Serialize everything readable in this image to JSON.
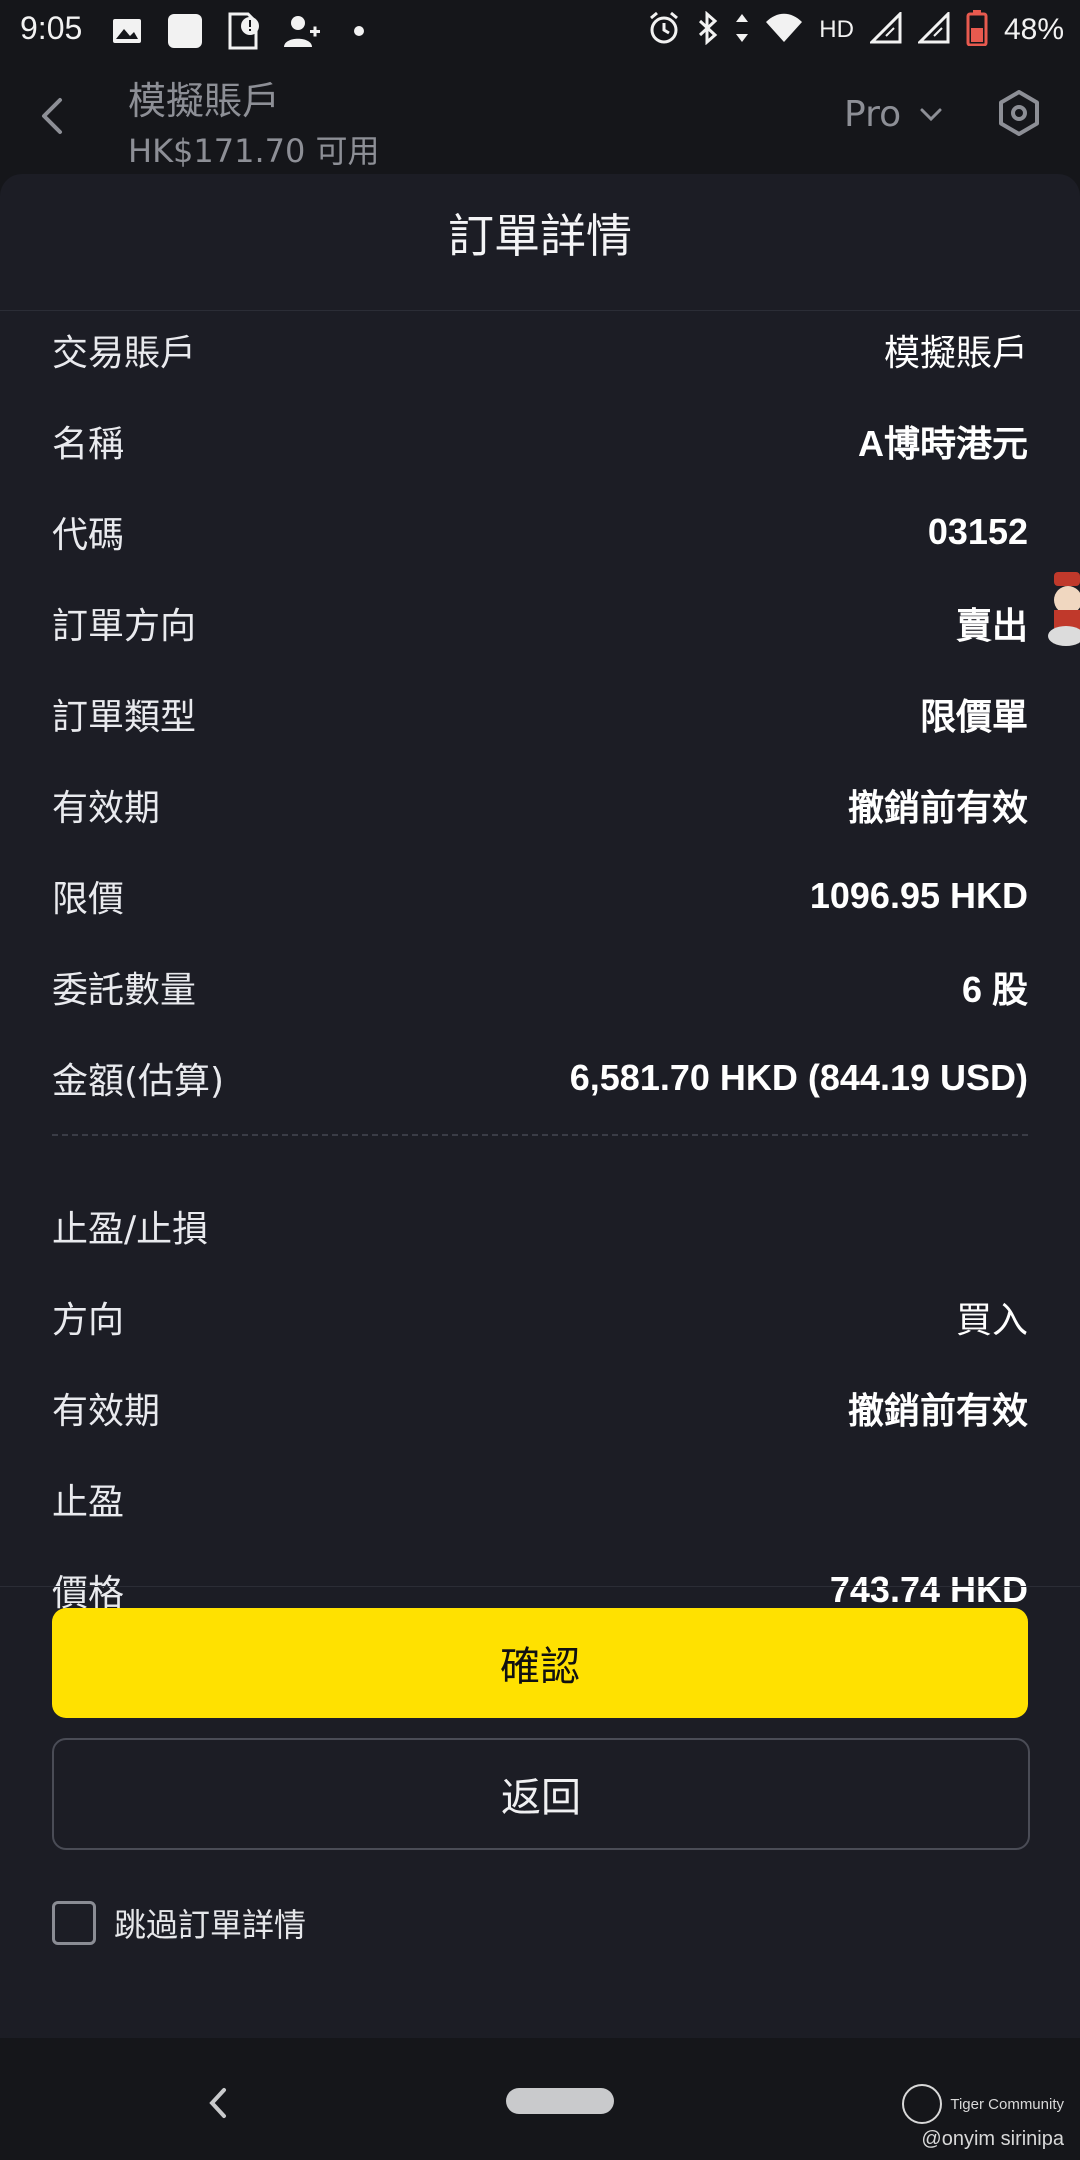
{
  "status_bar": {
    "time": "9:05",
    "battery": "48%",
    "network": "HD",
    "left_icons": [
      "image-icon",
      "square-icon",
      "sim-alert-icon",
      "person-add-icon",
      "dot-icon"
    ],
    "right_icons": [
      "alarm-icon",
      "bluetooth-icon",
      "data-arrows-icon",
      "wifi-icon",
      "signal-icon",
      "signal-icon",
      "battery-icon"
    ]
  },
  "header": {
    "account_name": "模擬賬戶",
    "available": "HK$171.70 可用",
    "mode": "Pro"
  },
  "sheet": {
    "title": "訂單詳情",
    "order_rows": [
      {
        "label": "交易賬戶",
        "value": "模擬賬戶"
      },
      {
        "label": "名稱",
        "value": "A博時港元"
      },
      {
        "label": "代碼",
        "value": "03152"
      },
      {
        "label": "訂單方向",
        "value": "賣出"
      },
      {
        "label": "訂單類型",
        "value": "限價單"
      },
      {
        "label": "有效期",
        "value": "撤銷前有效"
      },
      {
        "label": "限價",
        "value": "1096.95 HKD"
      },
      {
        "label": "委託數量",
        "value": "6 股"
      },
      {
        "label": "金額(估算)",
        "value": "6,581.70 HKD (844.19 USD)"
      }
    ],
    "tp_sl": {
      "section_label": "止盈/止損",
      "rows": [
        {
          "label": "方向",
          "value": "買入"
        },
        {
          "label": "有效期",
          "value": "撤銷前有效"
        }
      ],
      "take_profit_label": "止盈",
      "partial_label": "價格",
      "partial_value": "743.74 HKD"
    },
    "confirm_button": "確認",
    "back_button": "返回",
    "skip_checkbox_label": "跳過訂單詳情",
    "skip_checked": false
  },
  "watermark": {
    "brand": "Tiger Community",
    "user": "@onyim sirinipa"
  },
  "colors": {
    "accent": "#ffe100",
    "sheet_bg": "#1c1d25",
    "page_bg": "#15161a"
  }
}
